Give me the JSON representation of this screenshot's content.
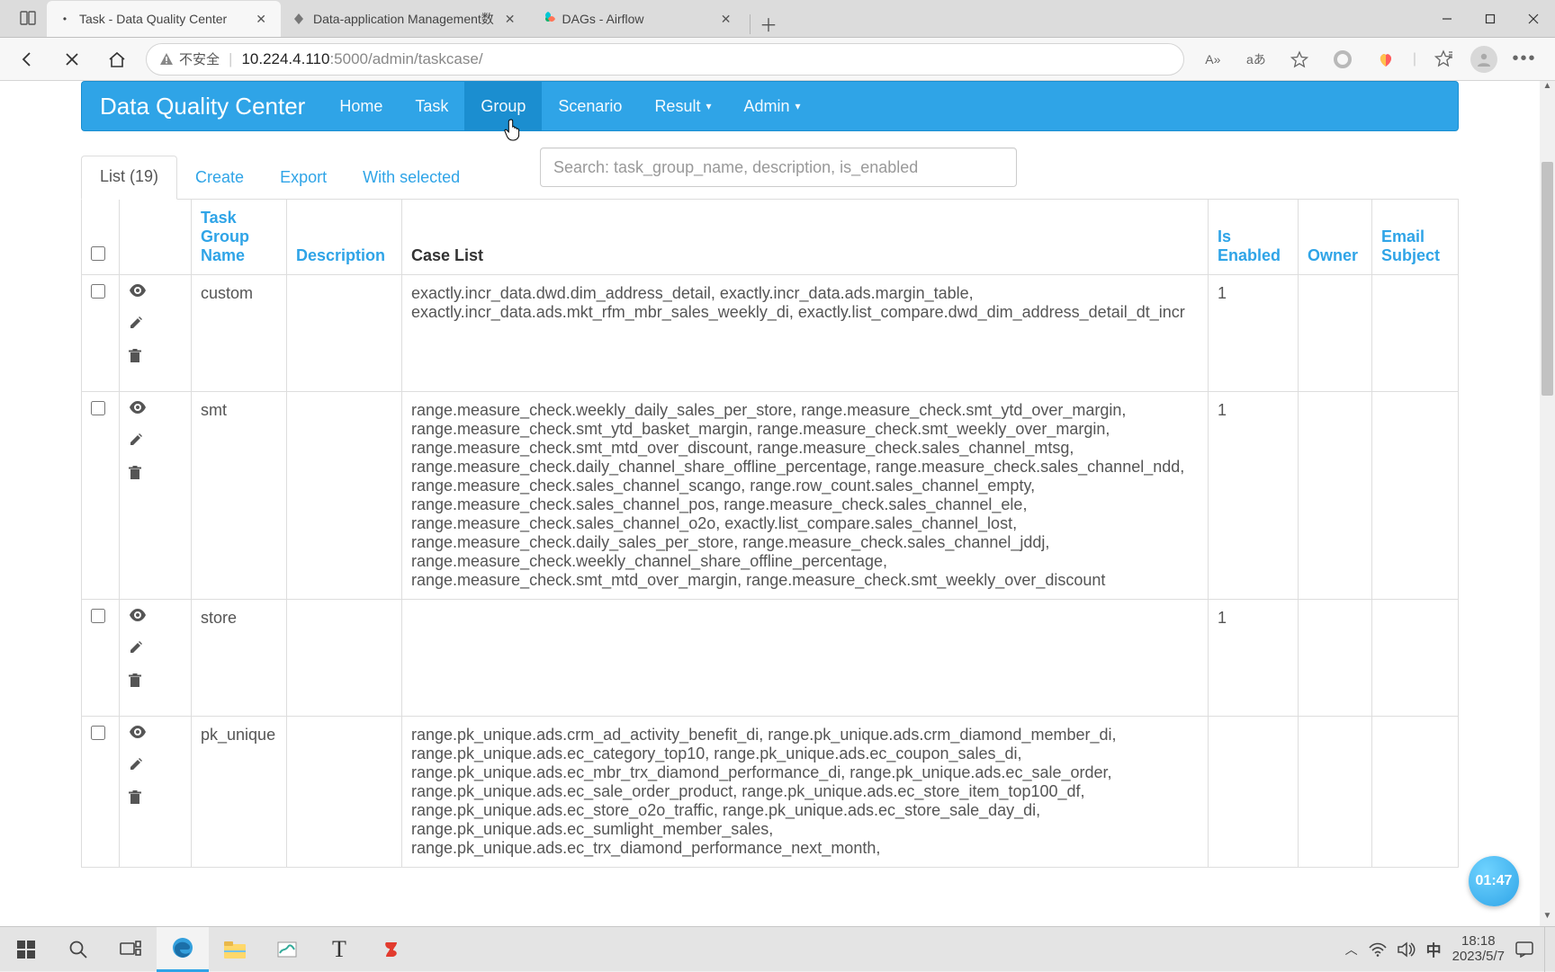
{
  "browser": {
    "tabs": [
      {
        "title": "Task - Data Quality Center",
        "active": true
      },
      {
        "title": "Data-application Management数",
        "active": false
      },
      {
        "title": "DAGs - Airflow",
        "active": false
      }
    ],
    "insecure_label": "不安全",
    "url_host": "10.224.4.110",
    "url_rest": ":5000/admin/taskcase/",
    "reader_label": "A»",
    "translate_label": "aあ"
  },
  "app": {
    "brand": "Data Quality Center",
    "nav": [
      "Home",
      "Task",
      "Group",
      "Scenario",
      "Result",
      "Admin"
    ],
    "nav_active": "Group",
    "nav_dropdown": [
      "Result",
      "Admin"
    ]
  },
  "tabs": {
    "list_label": "List (19)",
    "create": "Create",
    "export": "Export",
    "with_selected": "With selected",
    "search_placeholder": "Search: task_group_name, description, is_enabled"
  },
  "columns": {
    "task_group_name": "Task Group Name",
    "description": "Description",
    "case_list": "Case List",
    "is_enabled": "Is Enabled",
    "owner": "Owner",
    "email_subject": "Email Subject"
  },
  "rows": [
    {
      "name": "custom",
      "description": "",
      "case_list": "exactly.incr_data.dwd.dim_address_detail, exactly.incr_data.ads.margin_table, exactly.incr_data.ads.mkt_rfm_mbr_sales_weekly_di, exactly.list_compare.dwd_dim_address_detail_dt_incr",
      "is_enabled": "1",
      "owner": "",
      "email_subject": ""
    },
    {
      "name": "smt",
      "description": "",
      "case_list": "range.measure_check.weekly_daily_sales_per_store, range.measure_check.smt_ytd_over_margin, range.measure_check.smt_ytd_basket_margin, range.measure_check.smt_weekly_over_margin, range.measure_check.smt_mtd_over_discount, range.measure_check.sales_channel_mtsg, range.measure_check.daily_channel_share_offline_percentage, range.measure_check.sales_channel_ndd, range.measure_check.sales_channel_scango, range.row_count.sales_channel_empty, range.measure_check.sales_channel_pos, range.measure_check.sales_channel_ele, range.measure_check.sales_channel_o2o, exactly.list_compare.sales_channel_lost, range.measure_check.daily_sales_per_store, range.measure_check.sales_channel_jddj, range.measure_check.weekly_channel_share_offline_percentage, range.measure_check.smt_mtd_over_margin, range.measure_check.smt_weekly_over_discount",
      "is_enabled": "1",
      "owner": "",
      "email_subject": ""
    },
    {
      "name": "store",
      "description": "",
      "case_list": "",
      "is_enabled": "1",
      "owner": "",
      "email_subject": ""
    },
    {
      "name": "pk_unique",
      "description": "",
      "case_list": "range.pk_unique.ads.crm_ad_activity_benefit_di, range.pk_unique.ads.crm_diamond_member_di, range.pk_unique.ads.ec_category_top10, range.pk_unique.ads.ec_coupon_sales_di, range.pk_unique.ads.ec_mbr_trx_diamond_performance_di, range.pk_unique.ads.ec_sale_order, range.pk_unique.ads.ec_sale_order_product, range.pk_unique.ads.ec_store_item_top100_df, range.pk_unique.ads.ec_store_o2o_traffic, range.pk_unique.ads.ec_store_sale_day_di, range.pk_unique.ads.ec_sumlight_member_sales, range.pk_unique.ads.ec_trx_diamond_performance_next_month,",
      "is_enabled": "",
      "owner": "",
      "email_subject": ""
    }
  ],
  "float_clock": "01:47",
  "taskbar": {
    "time": "18:18",
    "date": "2023/5/7",
    "ime": "中"
  }
}
